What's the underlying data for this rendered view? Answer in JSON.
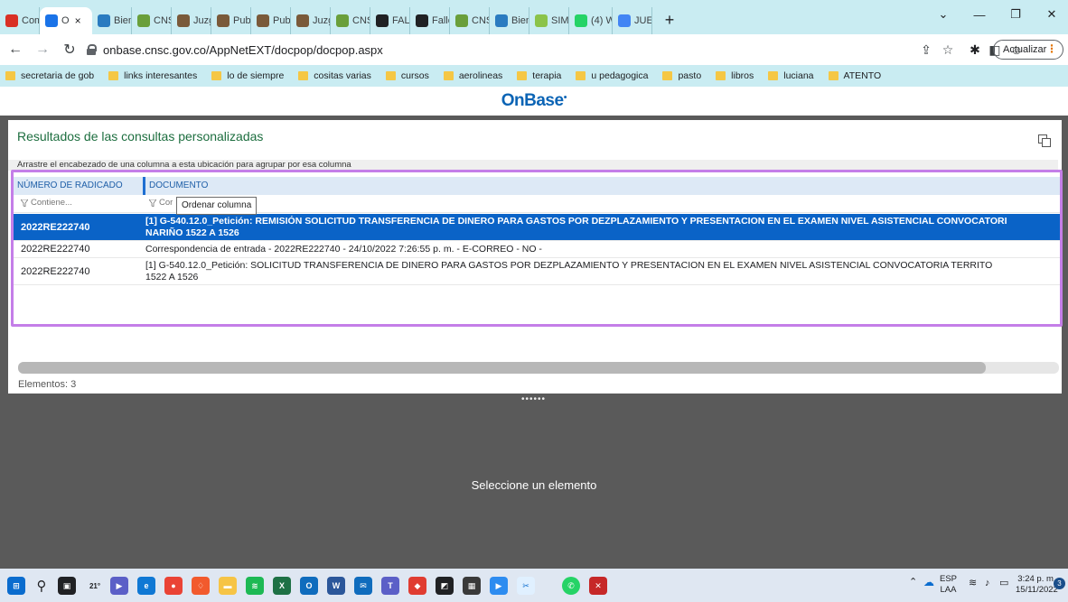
{
  "browser": {
    "tabs": [
      {
        "label": "Com",
        "favicon": "gmail-icon",
        "color": "#d93025"
      },
      {
        "label": "O",
        "favicon": "browser-icon",
        "color": "#1a73e8",
        "active": true
      },
      {
        "label": "Bien",
        "favicon": "cnsc-icon",
        "color": "#2a7bc0"
      },
      {
        "label": "CNSC",
        "favicon": "cnsc-icon",
        "color": "#6a9f3b"
      },
      {
        "label": "Juzg",
        "favicon": "judicial-icon",
        "color": "#7a5a3a"
      },
      {
        "label": "Publ",
        "favicon": "judicial-icon",
        "color": "#7a5a3a"
      },
      {
        "label": "Publ",
        "favicon": "judicial-icon",
        "color": "#7a5a3a"
      },
      {
        "label": "Juzg",
        "favicon": "judicial-icon",
        "color": "#7a5a3a"
      },
      {
        "label": "CNSC",
        "favicon": "cnsc-icon",
        "color": "#6a9f3b"
      },
      {
        "label": "FALL",
        "favicon": "github-icon",
        "color": "#202124"
      },
      {
        "label": "Fallo",
        "favicon": "github-icon",
        "color": "#202124"
      },
      {
        "label": "CNSC",
        "favicon": "cnsc-icon",
        "color": "#6a9f3b"
      },
      {
        "label": "Bien",
        "favicon": "cnsc-icon",
        "color": "#2a7bc0"
      },
      {
        "label": "SIMC",
        "favicon": "simo-icon",
        "color": "#8bc34a"
      },
      {
        "label": "(4) W",
        "favicon": "whatsapp-icon",
        "color": "#25d366"
      },
      {
        "label": "JUEZ",
        "favicon": "google-icon",
        "color": "#4285f4"
      }
    ],
    "tab_close_glyph": "×",
    "new_tab_glyph": "+",
    "url": "onbase.cnsc.gov.co/AppNetEXT/docpop/docpop.aspx",
    "update_label": "Actualizar",
    "bookmarks": [
      "secretaria de gob",
      "links interesantes",
      "lo de siempre",
      "cositas varias",
      "cursos",
      "aerolineas",
      "terapia",
      "u pedagogica",
      "pasto",
      "libros",
      "luciana",
      "ATENTO"
    ]
  },
  "app": {
    "logo": "OnBase",
    "results_title": "Resultados de las consultas personalizadas",
    "group_hint": "Arrastre el encabezado de una columna a esta ubicación para agrupar por esa columna",
    "columns": [
      "NÚMERO DE RADICADO",
      "DOCUMENTO"
    ],
    "filter_placeholder_1": "Contiene...",
    "filter_placeholder_2": "Cor",
    "tooltip": "Ordenar columna",
    "rows": [
      {
        "radicado": "2022RE222740",
        "documento_line1": "[1] G-540.12.0_Petición: REMISIÓN SOLICITUD TRANSFERENCIA DE DINERO PARA GASTOS POR DEZPLAZAMIENTO Y PRESENTACION EN EL EXAMEN NIVEL ASISTENCIAL CONVOCATORI",
        "documento_line2": "NARIÑO 1522 A 1526",
        "selected": true
      },
      {
        "radicado": "2022RE222740",
        "documento_line1": "Correspondencia de entrada - 2022RE222740 - 24/10/2022 7:26:55 p. m. - E-CORREO - NO -",
        "documento_line2": "",
        "selected": false
      },
      {
        "radicado": "2022RE222740",
        "documento_line1": "[1] G-540.12.0_Petición: SOLICITUD TRANSFERENCIA DE DINERO PARA GASTOS POR DEZPLAZAMIENTO Y PRESENTACION EN EL EXAMEN NIVEL ASISTENCIAL CONVOCATORIA TERRITO",
        "documento_line2": "1522 A 1526",
        "selected": false
      }
    ],
    "scroll_position": 0.93,
    "item_count": "Elementos: 3",
    "splitter_glyph": "••••••",
    "empty_message": "Seleccione un elemento"
  },
  "taskbar": {
    "weather": "21°",
    "lang_top": "ESP",
    "lang_bottom": "LAA",
    "time": "3:24 p. m.",
    "date": "15/11/2022",
    "notification_count": "3"
  },
  "colors": {
    "selection": "#0a63c7",
    "highlight_border": "#c47ee8",
    "title_green": "#1d6e3f",
    "logo_blue": "#0b64b5"
  }
}
